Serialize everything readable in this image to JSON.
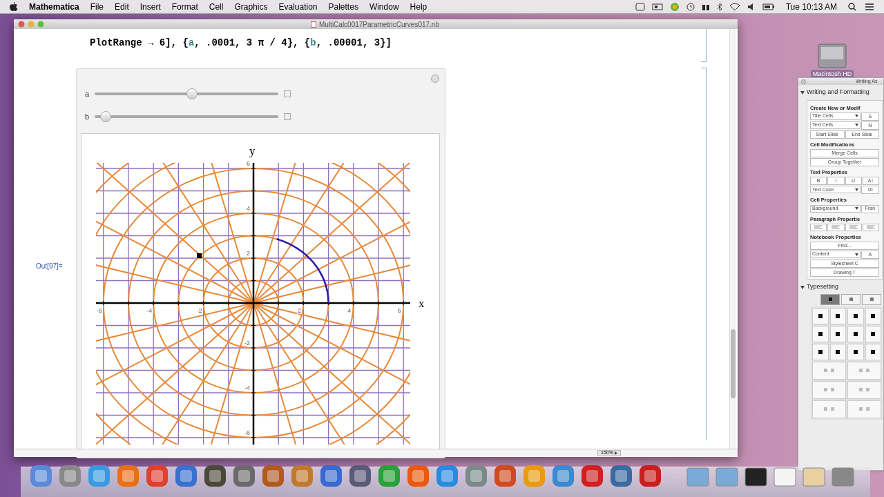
{
  "menu_bar": {
    "app": "Mathematica",
    "menus": [
      "File",
      "Edit",
      "Insert",
      "Format",
      "Cell",
      "Graphics",
      "Evaluation",
      "Palettes",
      "Window",
      "Help"
    ],
    "clock": "Tue 10:13 AM"
  },
  "notebook": {
    "title": "MultiCalc0017ParametricCurves017.nb",
    "code": [
      {
        "kind": "plain",
        "text": "PlotRange → 6], {"
      },
      {
        "kind": "variable",
        "text": "a"
      },
      {
        "kind": "plain",
        "text": ", .0001, 3 π / 4}, {"
      },
      {
        "kind": "variable",
        "text": "b"
      },
      {
        "kind": "plain",
        "text": ", .00001, 3}]"
      }
    ],
    "sliders": [
      {
        "label": "a",
        "level": 0.53
      },
      {
        "label": "b",
        "level": 0.03
      }
    ],
    "out_label": "Out[97]=",
    "plot": {
      "x_label": "x",
      "y_label": "y",
      "x_tick_labels": [
        "-6",
        "-4",
        "-2",
        "2",
        "4",
        "6"
      ],
      "y_tick_labels": [
        "6",
        "4",
        "2",
        "-2",
        "-4",
        "-6"
      ]
    },
    "zoom": "150%"
  },
  "desktop_icon": {
    "label": "Macintosh HD"
  },
  "palette": {
    "title": "Writing As",
    "section": "Writing and Formatting",
    "groups": [
      {
        "title": "Create New or Modif",
        "rows": [
          {
            "items": [
              {
                "kind": "dropdown",
                "label": "Title Cells"
              },
              {
                "kind": "button",
                "label": "S"
              }
            ]
          },
          {
            "items": [
              {
                "kind": "dropdown",
                "label": "Text Cells"
              },
              {
                "kind": "button",
                "label": "N"
              }
            ]
          },
          {
            "items": [
              {
                "kind": "button",
                "label": "Start Slide"
              },
              {
                "kind": "button",
                "label": "End Slide"
              }
            ]
          }
        ]
      },
      {
        "title": "Cell Modifications",
        "rows": [
          {
            "items": [
              {
                "kind": "button",
                "label": "Merge Cells"
              }
            ]
          },
          {
            "items": [
              {
                "kind": "button",
                "label": "Group Together"
              }
            ]
          }
        ]
      },
      {
        "title": "Text Properties",
        "rows": [
          {
            "items": [
              {
                "kind": "button",
                "label": "B"
              },
              {
                "kind": "button",
                "label": "I"
              },
              {
                "kind": "button",
                "label": "U"
              },
              {
                "kind": "button",
                "label": "A↑"
              }
            ]
          },
          {
            "items": [
              {
                "kind": "dropdown",
                "label": "Text Color"
              },
              {
                "kind": "button",
                "label": "10"
              }
            ]
          }
        ]
      },
      {
        "title": "Cell Properties",
        "rows": [
          {
            "items": [
              {
                "kind": "dropdown",
                "label": "Background"
              },
              {
                "kind": "button",
                "label": "Fran"
              }
            ]
          }
        ]
      },
      {
        "title": "Paragraph Propertie",
        "rows": [
          {
            "items": [
              {
                "kind": "icon"
              },
              {
                "kind": "icon"
              },
              {
                "kind": "icon"
              },
              {
                "kind": "icon"
              }
            ]
          }
        ]
      },
      {
        "title": "Notebook Properties",
        "rows": [
          {
            "items": [
              {
                "kind": "button",
                "label": "Find..."
              }
            ]
          },
          {
            "items": [
              {
                "kind": "dropdown",
                "label": "Content"
              },
              {
                "kind": "button",
                "label": "A"
              }
            ]
          },
          {
            "items": [
              {
                "kind": "button",
                "label": "Stylesheet C"
              }
            ]
          },
          {
            "items": [
              {
                "kind": "button",
                "label": "Drawing T"
              }
            ]
          }
        ]
      }
    ],
    "section2": "Typesetting",
    "typesetting_tabs": [
      {
        "selected": true
      },
      {
        "selected": false
      },
      {
        "selected": false
      }
    ]
  }
}
